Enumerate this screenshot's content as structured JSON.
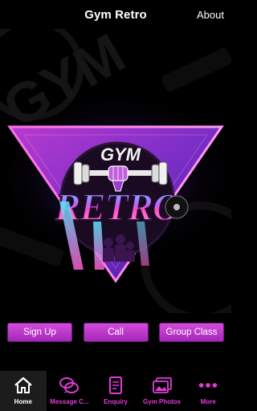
{
  "header": {
    "title": "Gym Retro",
    "about_label": "About"
  },
  "logo": {
    "word_top": "GYM",
    "word_main": "RETRO",
    "watermark": "GYM"
  },
  "actions": [
    {
      "label": "Sign Up"
    },
    {
      "label": "Call"
    },
    {
      "label": "Group Class"
    }
  ],
  "tabs": [
    {
      "label": "Home",
      "icon": "home-icon",
      "active": true
    },
    {
      "label": "Message C...",
      "icon": "chat-bubbles-icon",
      "active": false
    },
    {
      "label": "Enquiry",
      "icon": "form-icon",
      "active": false
    },
    {
      "label": "Gym Photos",
      "icon": "photos-icon",
      "active": false
    },
    {
      "label": "More",
      "icon": "more-dots-icon",
      "active": false
    }
  ],
  "colors": {
    "accent": "#e23bd8",
    "button_top": "#d64ddc",
    "button_bottom": "#a225b8",
    "background": "#000000"
  }
}
